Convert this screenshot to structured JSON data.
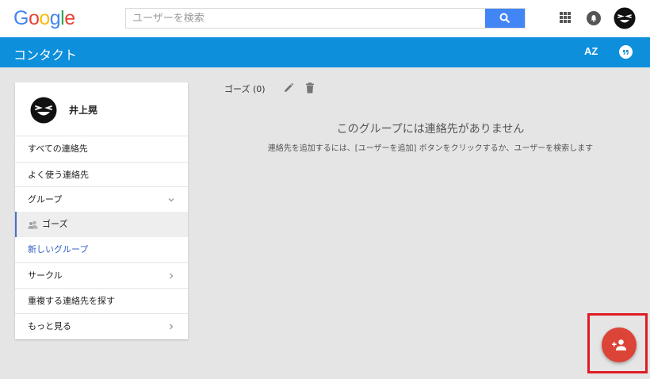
{
  "header": {
    "logo_letters": [
      {
        "ch": "G",
        "color": "#4285f4"
      },
      {
        "ch": "o",
        "color": "#ea4335"
      },
      {
        "ch": "o",
        "color": "#fbbc05"
      },
      {
        "ch": "g",
        "color": "#4285f4"
      },
      {
        "ch": "l",
        "color": "#34a853"
      },
      {
        "ch": "e",
        "color": "#ea4335"
      }
    ],
    "search_placeholder": "ユーザーを検索",
    "search_value": "",
    "icons": [
      "apps-grid-icon",
      "notifications-bell-icon",
      "account-avatar"
    ]
  },
  "app_bar": {
    "title": "コンタクト",
    "sort_label": "AZ",
    "background": "#0d8fdb"
  },
  "sidebar": {
    "user_name": "井上晃",
    "items": [
      {
        "label": "すべての連絡先"
      },
      {
        "label": "よく使う連絡先"
      },
      {
        "label": "グループ"
      },
      {
        "label": "ゴーズ"
      },
      {
        "label": "新しいグループ"
      },
      {
        "label": "サークル"
      },
      {
        "label": "重複する連絡先を探す"
      },
      {
        "label": "もっと見る"
      }
    ]
  },
  "main": {
    "group_title": "ゴーズ (0)",
    "empty_title": "このグループには連絡先がありません",
    "empty_description": "連絡先を追加するには、[ユーザーを追加] ボタンをクリックするか、ユーザーを検索します"
  },
  "fab": {
    "icon": "add-person-icon",
    "color": "#db4437",
    "highlight_color": "#e01b24"
  }
}
